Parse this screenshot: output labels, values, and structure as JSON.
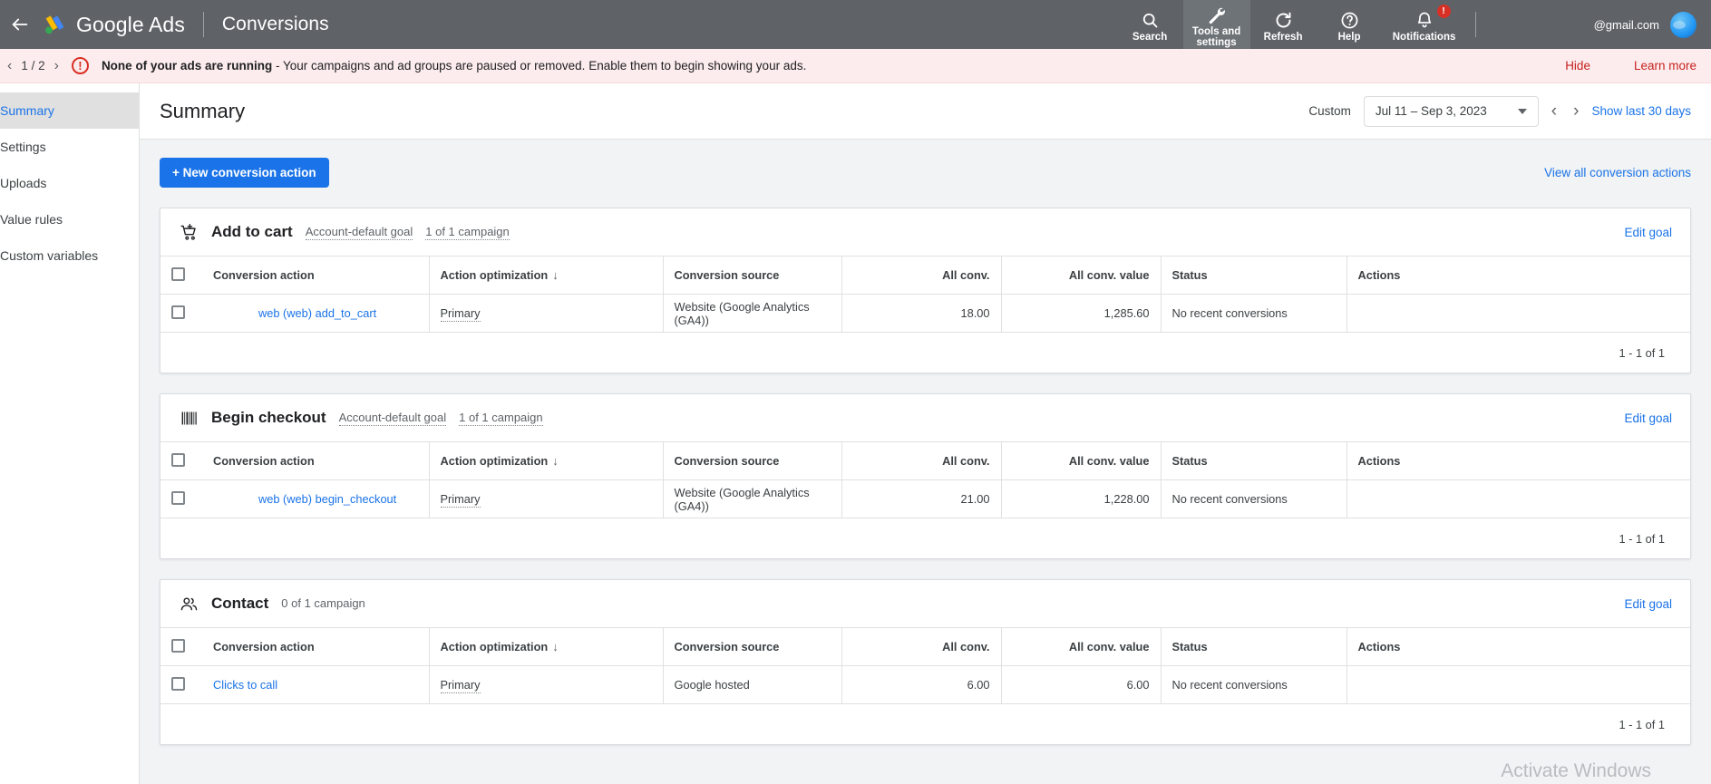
{
  "topbar": {
    "back_icon": "back-arrow-icon",
    "brand": "Google Ads",
    "context": "Conversions",
    "items": [
      {
        "label": "Search",
        "icon": "search-icon",
        "active": false
      },
      {
        "label": "Tools and settings",
        "icon": "wrench-icon",
        "active": true
      },
      {
        "label": "Refresh",
        "icon": "refresh-icon",
        "active": false
      },
      {
        "label": "Help",
        "icon": "help-icon",
        "active": false
      },
      {
        "label": "Notifications",
        "icon": "bell-icon",
        "active": false,
        "badge": "!"
      }
    ],
    "account_email": "@gmail.com"
  },
  "alert": {
    "counter": "1 / 2",
    "prev_icon": "chevron-left-icon",
    "next_icon": "chevron-right-icon",
    "warning_icon": "exclamation-circle-icon",
    "headline": "None of your ads are running",
    "detail": " - Your campaigns and ad groups are paused or removed. Enable them to begin showing your ads.",
    "hide_label": "Hide",
    "learn_more_label": "Learn more"
  },
  "sidebar": {
    "items": [
      {
        "label": "Summary",
        "active": true
      },
      {
        "label": "Settings",
        "active": false
      },
      {
        "label": "Uploads",
        "active": false
      },
      {
        "label": "Value rules",
        "active": false
      },
      {
        "label": "Custom variables",
        "active": false
      }
    ]
  },
  "header": {
    "title": "Summary",
    "date_label": "Custom",
    "date_value": "Jul 11 – Sep 3, 2023",
    "prev_icon": "chevron-left-icon",
    "next_icon": "chevron-right-icon",
    "show_last_30": "Show last 30 days"
  },
  "toolbar": {
    "new_action_label": "+ New conversion action",
    "view_all_label": "View all conversion actions"
  },
  "table_columns": {
    "conversion_action": "Conversion action",
    "action_optimization": "Action optimization",
    "conversion_source": "Conversion source",
    "all_conv": "All conv.",
    "all_conv_value": "All conv. value",
    "status": "Status",
    "actions": "Actions"
  },
  "cards": [
    {
      "icon": "shopping-cart-icon",
      "title": "Add to cart",
      "goal_type": "Account-default goal",
      "campaign_count": "1 of 1 campaign",
      "edit_label": "Edit goal",
      "footer": "1 - 1 of 1",
      "rows": [
        {
          "action": "web (web) add_to_cart",
          "action_indent": true,
          "optimization": "Primary",
          "source": "Website (Google Analytics (GA4))",
          "all_conv": "18.00",
          "all_conv_value": "1,285.60",
          "status": "No recent conversions",
          "actions": ""
        }
      ]
    },
    {
      "icon": "barcode-icon",
      "title": "Begin checkout",
      "goal_type": "Account-default goal",
      "campaign_count": "1 of 1 campaign",
      "edit_label": "Edit goal",
      "footer": "1 - 1 of 1",
      "rows": [
        {
          "action": "web (web) begin_checkout",
          "action_indent": true,
          "optimization": "Primary",
          "source": "Website (Google Analytics (GA4))",
          "all_conv": "21.00",
          "all_conv_value": "1,228.00",
          "status": "No recent conversions",
          "actions": ""
        }
      ]
    },
    {
      "icon": "people-icon",
      "title": "Contact",
      "goal_type": "",
      "campaign_count": "0 of 1 campaign",
      "edit_label": "Edit goal",
      "footer": "1 - 1 of 1",
      "rows": [
        {
          "action": "Clicks to call",
          "action_indent": false,
          "optimization": "Primary",
          "source": "Google hosted",
          "all_conv": "6.00",
          "all_conv_value": "6.00",
          "status": "No recent conversions",
          "actions": ""
        }
      ]
    }
  ],
  "watermark": "Activate Windows",
  "colors": {
    "accent": "#1a73e8",
    "topbar": "#5f6368",
    "alert_bg": "#fdeced",
    "alert_red": "#d93025",
    "page_bg": "#f1f3f4"
  }
}
